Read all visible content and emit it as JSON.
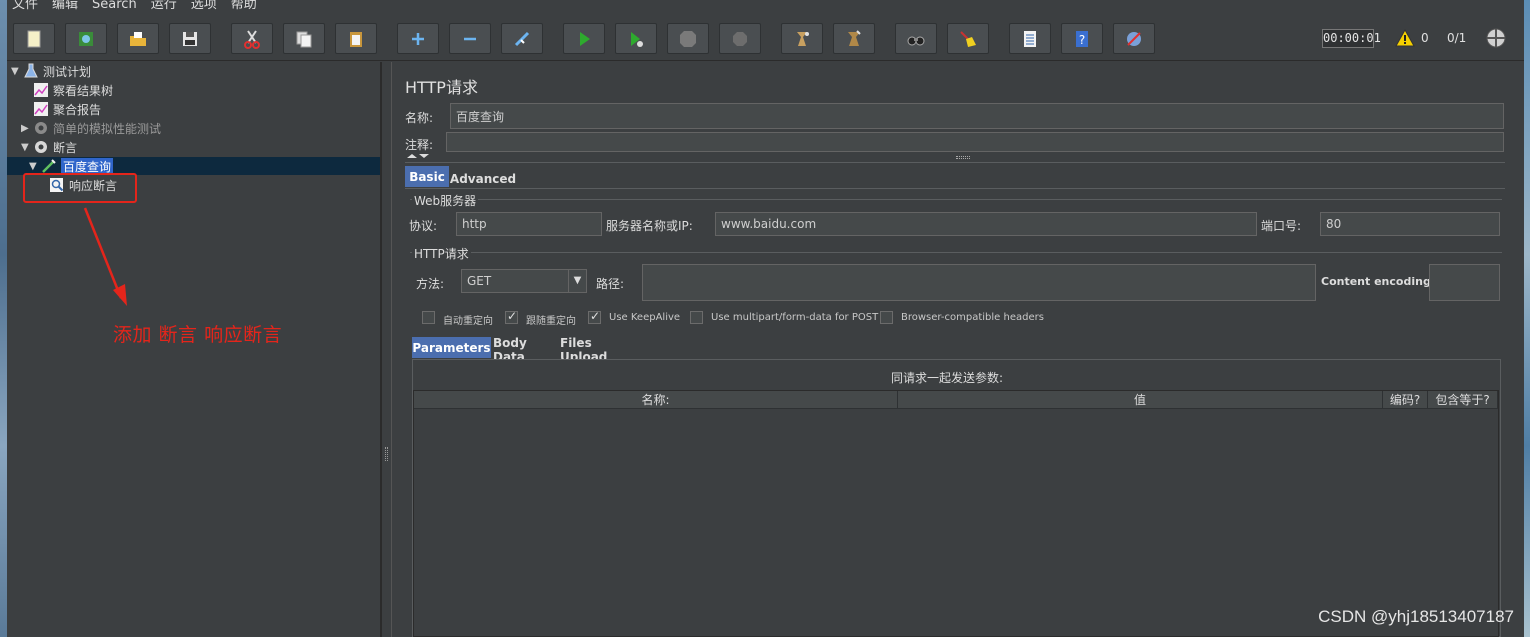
{
  "menu": [
    "文件",
    "编辑",
    "Search",
    "运行",
    "选项",
    "帮助"
  ],
  "toolbar": {
    "buttons": [
      "new-icon",
      "templates-icon",
      "open-icon",
      "save-icon",
      "cut-icon",
      "copy-icon",
      "paste-icon",
      "expand-icon",
      "collapse-icon",
      "toggle-icon",
      "start-icon",
      "start-no-pause-icon",
      "stop-icon",
      "shutdown-icon",
      "clear-icon",
      "clear-all-icon",
      "search-icon",
      "reset-search-icon",
      "function-helper-icon",
      "help-icon",
      "remote-icon"
    ],
    "timer": "00:00:01",
    "warnings": "0",
    "threads": "0/1"
  },
  "tree": {
    "nodes": [
      {
        "label": "测试计划",
        "level": 0,
        "expanded": true
      },
      {
        "label": "察看结果树",
        "level": 1
      },
      {
        "label": "聚合报告",
        "level": 1
      },
      {
        "label": "简单的模拟性能测试",
        "level": 1,
        "expanded": false
      },
      {
        "label": "断言",
        "level": 1,
        "expanded": true
      },
      {
        "label": "百度查询",
        "level": 2,
        "expanded": true,
        "selected": true
      },
      {
        "label": "响应断言",
        "level": 3
      }
    ],
    "annotation": "添加  断言  响应断言"
  },
  "main": {
    "title": "HTTP请求",
    "name_label": "名称:",
    "name_value": "百度查询",
    "comment_label": "注释:",
    "comment_value": "",
    "tabs": [
      "Basic",
      "Advanced"
    ],
    "web_server": {
      "group_title": "Web服务器",
      "protocol_label": "协议:",
      "protocol_value": "http",
      "server_label": "服务器名称或IP:",
      "server_value": "www.baidu.com",
      "port_label": "端口号:",
      "port_value": "80"
    },
    "http_request": {
      "group_title": "HTTP请求",
      "method_label": "方法:",
      "method_value": "GET",
      "path_label": "路径:",
      "path_value": "",
      "encoding_label": "Content encoding:",
      "encoding_value": ""
    },
    "checkboxes": [
      {
        "label": "自动重定向",
        "checked": false
      },
      {
        "label": "跟随重定向",
        "checked": true
      },
      {
        "label": "Use KeepAlive",
        "checked": true
      },
      {
        "label": "Use multipart/form-data for POST",
        "checked": false
      },
      {
        "label": "Browser-compatible headers",
        "checked": false
      }
    ],
    "sub_tabs": [
      "Parameters",
      "Body Data",
      "Files Upload"
    ],
    "params_title": "同请求一起发送参数:",
    "columns": [
      "名称:",
      "值",
      "编码?",
      "包含等于?"
    ]
  },
  "watermark": "CSDN @yhj18513407187",
  "colors": {
    "selection": "#2f65ca",
    "accent_tab": "#4b6eaf",
    "annotation": "#e4251b"
  }
}
